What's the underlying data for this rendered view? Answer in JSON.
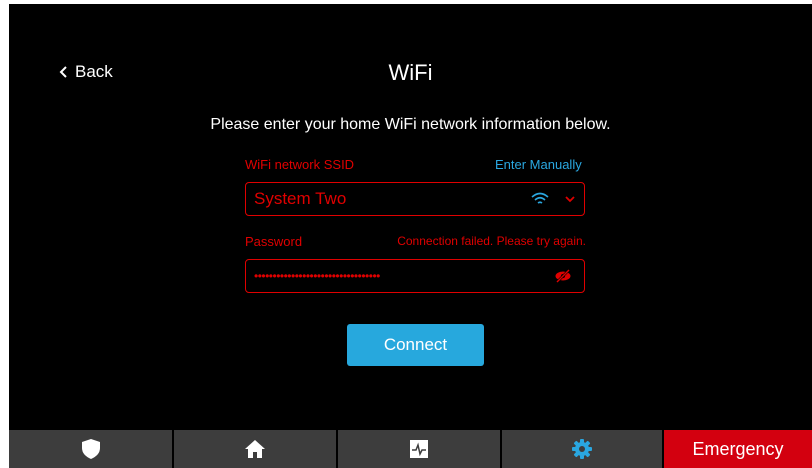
{
  "header": {
    "back_label": "Back",
    "title": "WiFi"
  },
  "instruction": "Please enter your home WiFi network information below.",
  "ssid": {
    "label": "WiFi network SSID",
    "enter_manually": "Enter Manually",
    "value": "System Two",
    "icons": [
      "wifi-icon",
      "chevron-down-icon"
    ]
  },
  "password": {
    "label": "Password",
    "error": "Connection failed. Please try again.",
    "masked_value": "••••••••••••••••••••••••••••••••••",
    "icon": "eye-off-icon"
  },
  "connect_label": "Connect",
  "bottom_nav": {
    "items": [
      "shield-icon",
      "home-icon",
      "activity-icon",
      "gear-icon"
    ],
    "emergency_label": "Emergency"
  },
  "colors": {
    "background": "#000000",
    "error_red": "#e00000",
    "accent_blue": "#27a8dd",
    "nav_gray": "#3d3d3d",
    "emergency_red": "#d3000f"
  }
}
